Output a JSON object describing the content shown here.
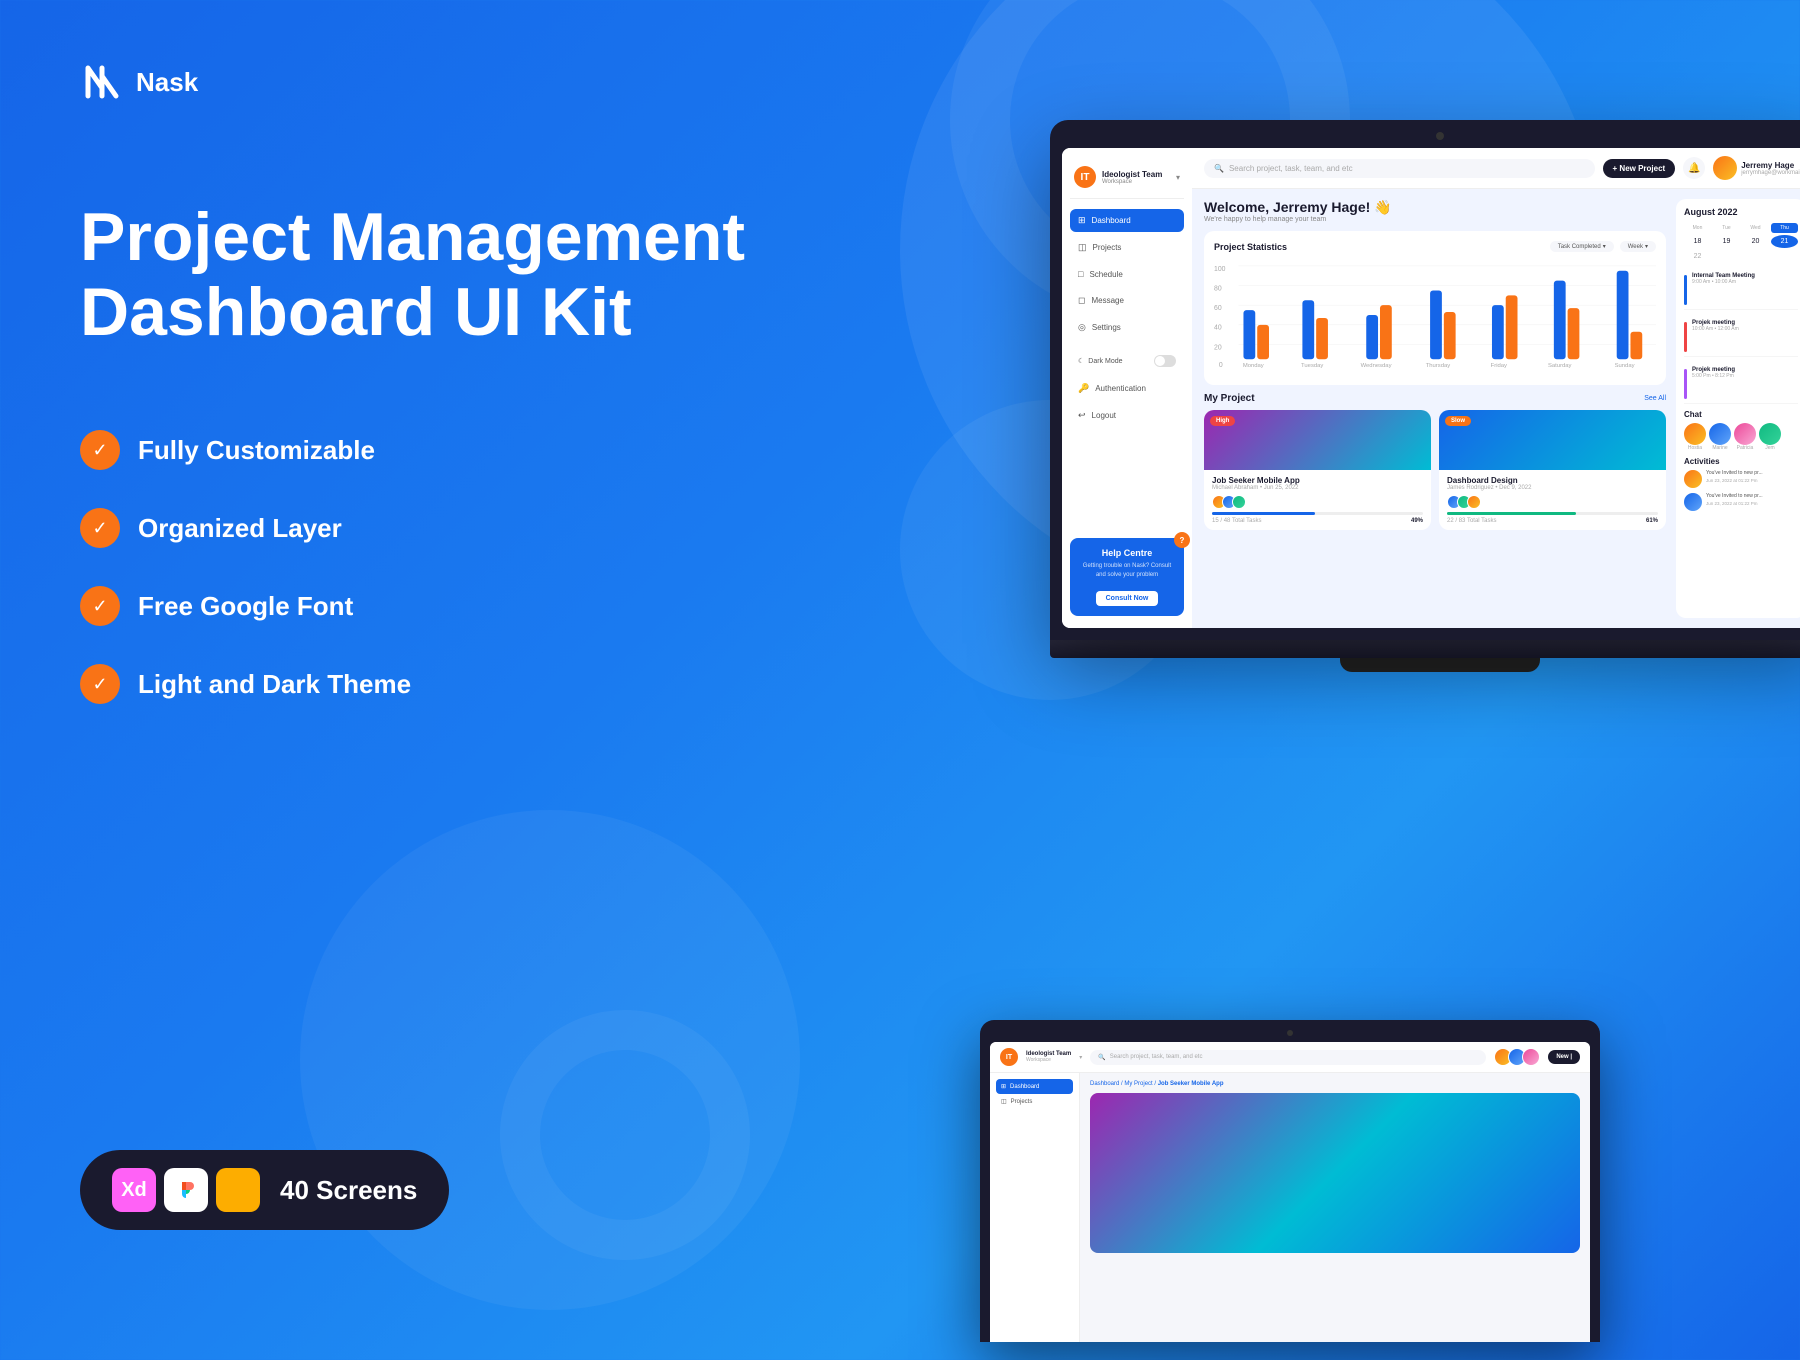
{
  "brand": {
    "name": "Nask"
  },
  "heading": {
    "line1": "Project Management",
    "line2": "Dashboard UI Kit"
  },
  "features": [
    {
      "label": "Fully Customizable"
    },
    {
      "label": "Organized Layer"
    },
    {
      "label": "Free Google Font"
    },
    {
      "label": "Light and Dark Theme"
    }
  ],
  "tools": {
    "screens_count": "40",
    "screens_label": " Screens",
    "xd_label": "Xd",
    "figma_label": "Fg",
    "sketch_label": "Sk"
  },
  "dashboard": {
    "workspace_name": "Ideologist Team",
    "workspace_sub": "Workspace",
    "search_placeholder": "Search project, task, team, and etc",
    "new_project_btn": "+ New Project",
    "user_name": "Jerremy Hage",
    "user_email": "jerrymhage@workmail...",
    "welcome_title": "Welcome, Jerremy Hage! 👋",
    "welcome_sub": "We're happy to help manage your team",
    "chart_title": "Project Statistics",
    "task_filter": "Task Completed",
    "week_filter": "Week",
    "chart_days": [
      "Monday",
      "Tuesday",
      "Wednesday",
      "Thursday",
      "Friday",
      "Saturday",
      "Sunday"
    ],
    "chart_bars": [
      {
        "blue": 55,
        "orange": 35
      },
      {
        "blue": 65,
        "orange": 42
      },
      {
        "blue": 48,
        "orange": 60
      },
      {
        "blue": 72,
        "orange": 45
      },
      {
        "blue": 58,
        "orange": 70
      },
      {
        "blue": 80,
        "orange": 55
      },
      {
        "blue": 90,
        "orange": 30
      }
    ],
    "my_project_title": "My Project",
    "see_all": "See All",
    "projects": [
      {
        "name": "Job Seeker Mobile App",
        "meta": "Michael Abraham • Jun 25, 2022",
        "badge": "High",
        "badge_type": "high",
        "total_tasks": "48",
        "done_tasks": "15",
        "pct": "49%"
      },
      {
        "name": "Dashboard Design",
        "meta": "James Rodriguez • Dec 9, 2022",
        "badge": "Slow",
        "badge_type": "slow",
        "total_tasks": "83",
        "done_tasks": "22",
        "pct": "61%"
      }
    ],
    "nav_items": [
      "Dashboard",
      "Projects",
      "Schedule",
      "Message",
      "Settings"
    ],
    "dark_mode_label": "Dark Mode",
    "auth_label": "Authentication",
    "logout_label": "Logout",
    "help_title": "Help Centre",
    "help_desc": "Getting trouble on Nask? Consult and solve your problem",
    "help_btn": "Consult Now",
    "calendar_month": "August 2022",
    "cal_cols": [
      "Mon",
      "Tue",
      "Wed",
      "Thu"
    ],
    "cal_days": [
      "18",
      "19",
      "20",
      "21",
      "22"
    ],
    "meetings": [
      {
        "title": "Internal Team Meeting",
        "time": "9:00 Am • 10:00 Am"
      },
      {
        "title": "Projek meeting",
        "time": "10:00 Am • 12:00 Am"
      },
      {
        "title": "Projek meeting",
        "time": "5:00 Pm • 8:12 Pm"
      }
    ],
    "chat_title": "Chat",
    "chat_people": [
      "Hostia",
      "Marine",
      "Patricia",
      "Jem"
    ],
    "activities_title": "Activities",
    "activities": [
      {
        "text": "You've Invited to new pr...",
        "date": "Jun 23, 2022 at 01:22 Pm"
      },
      {
        "text": "You've Invited to new pr...",
        "date": "Jun 23, 2022 at 01:22 Pm"
      }
    ]
  },
  "laptop2": {
    "workspace_name": "Ideologist Team",
    "workspace_sub": "Workspace",
    "search_placeholder": "Search project, task, team, and etc",
    "nav_items": [
      "Dashboard",
      "Projects"
    ],
    "breadcrumb": "Dashboard / My Project / Job Seeker Mobile App",
    "new_label": "New |"
  }
}
